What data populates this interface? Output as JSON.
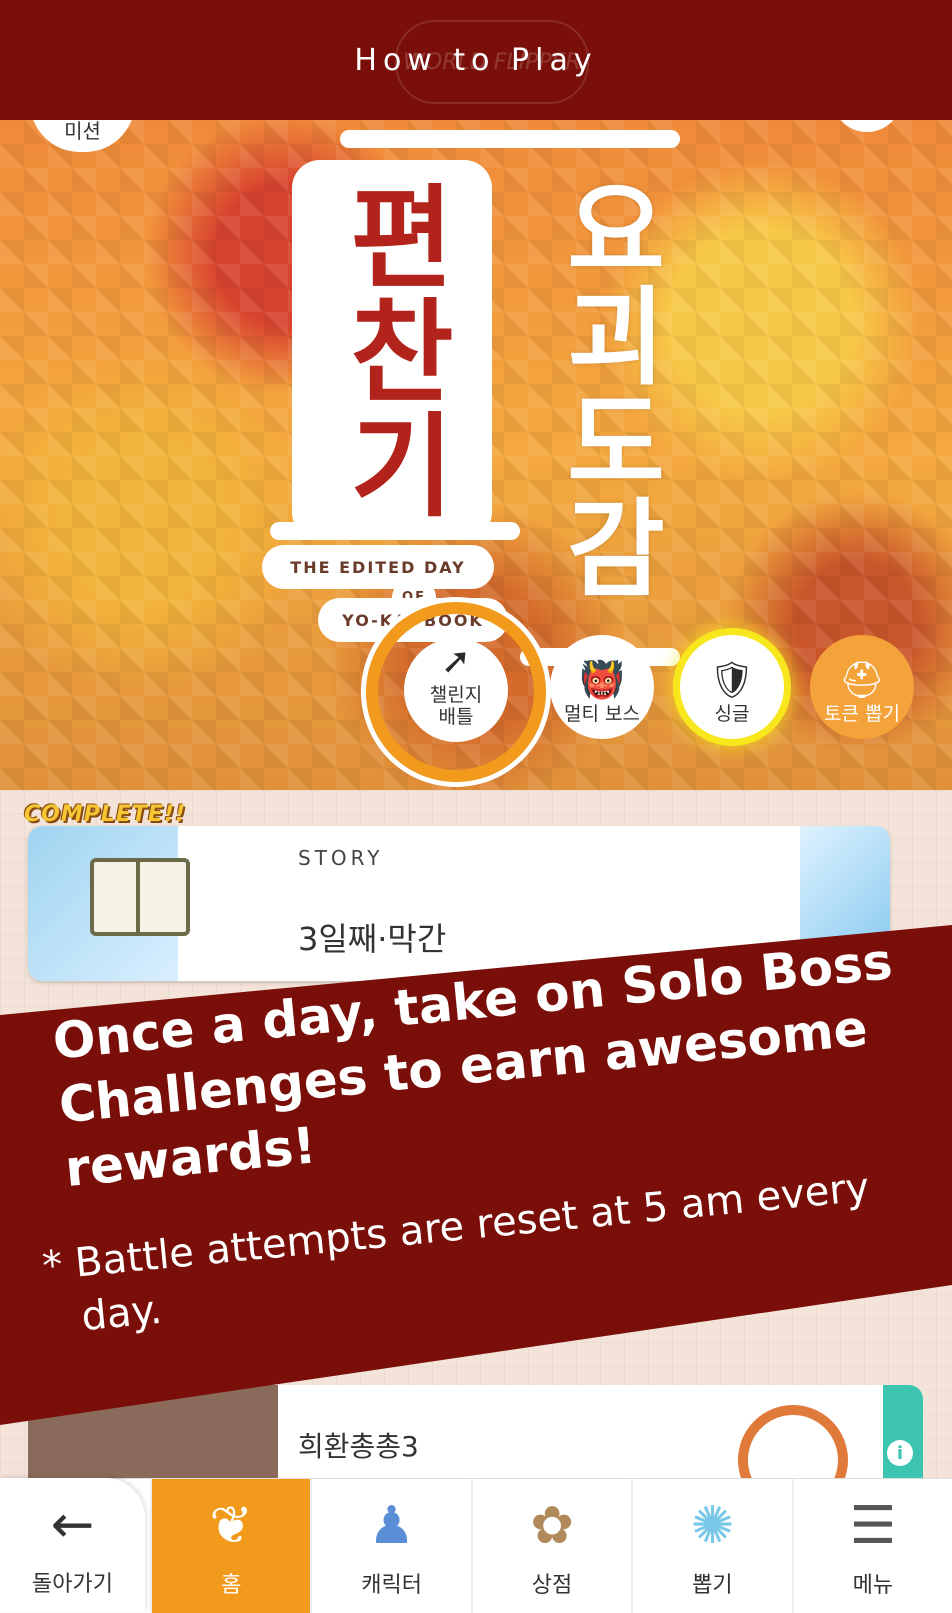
{
  "header": {
    "title": "How to Play",
    "logo_text": "WORLD FLIPPER"
  },
  "scene": {
    "mission_label": "미션",
    "title_main": "편찬기",
    "title_sub": "요괴도감",
    "subtitle_line1": "THE EDITED DAY",
    "subtitle_line2": "OF",
    "subtitle_line3": "YO-KAI BOOK",
    "modes": [
      {
        "label": "챌린지\n배틀",
        "icon": "challenge-icon"
      },
      {
        "label": "멀티 보스",
        "icon": "demon-icon"
      },
      {
        "label": "싱글",
        "icon": "knight-icon"
      },
      {
        "label": "토큰 뽑기",
        "icon": "hat-icon"
      }
    ]
  },
  "story": {
    "badge": "COMPLETE!!",
    "label": "STORY",
    "title": "3일째·막간"
  },
  "banner": {
    "headline": "Once a day, take on Solo Boss Challenges to earn awesome rewards!",
    "note": "* Battle attempts are reset at 5 am every day."
  },
  "bottom_card": {
    "name": "희환총총3"
  },
  "nav": {
    "back": "돌아가기",
    "items": [
      {
        "label": "홈",
        "icon": "home-icon",
        "active": true
      },
      {
        "label": "캐릭터",
        "icon": "character-icon",
        "active": false
      },
      {
        "label": "상점",
        "icon": "shop-icon",
        "active": false
      },
      {
        "label": "뽑기",
        "icon": "gacha-icon",
        "active": false
      },
      {
        "label": "메뉴",
        "icon": "menu-icon",
        "active": false
      }
    ]
  },
  "colors": {
    "header_bg": "#7a0f0a",
    "accent_orange": "#f29a1c",
    "title_red": "#b2231b"
  }
}
